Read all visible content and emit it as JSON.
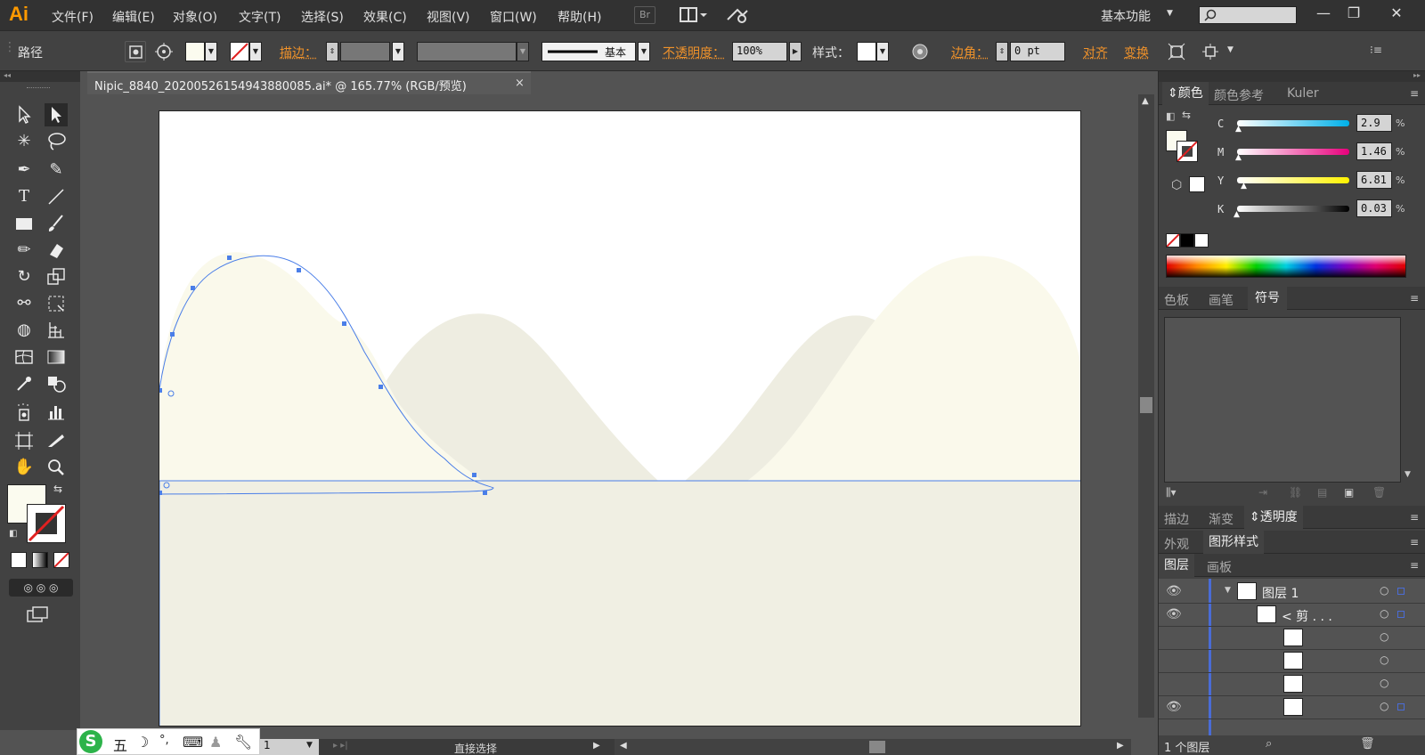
{
  "app": {
    "logo": "Ai"
  },
  "menu": [
    "文件(F)",
    "编辑(E)",
    "对象(O)",
    "文字(T)",
    "选择(S)",
    "效果(C)",
    "视图(V)",
    "窗口(W)",
    "帮助(H)"
  ],
  "menubar_icons": {
    "bridge": "Br"
  },
  "workspace": "基本功能",
  "controlbar": {
    "object_type": "路径",
    "stroke_label": "描边：",
    "brush_label": "基本",
    "opacity_label": "不透明度：",
    "opacity_value": "100%",
    "style_label": "样式：",
    "corner_label": "边角：",
    "corner_value": "0 pt",
    "align_label": "对齐",
    "transform_label": "变换"
  },
  "document": {
    "tab_title": "Nipic_8840_20200526154943880085.ai* @ 165.77% (RGB/预览)",
    "zoom": "1",
    "status": "直接选择"
  },
  "color_panel": {
    "tabs": [
      "颜色",
      "颜色参考",
      "Kuler"
    ],
    "channels": [
      {
        "label": "C",
        "value": "2.9"
      },
      {
        "label": "M",
        "value": "1.46"
      },
      {
        "label": "Y",
        "value": "6.81"
      },
      {
        "label": "K",
        "value": "0.03"
      }
    ],
    "percent": "%",
    "fill_color": "#fbfbef"
  },
  "swatch_panel": {
    "tabs": [
      "色板",
      "画笔",
      "符号"
    ]
  },
  "stroke_panel": {
    "tabs": [
      "描边",
      "渐变",
      "透明度"
    ]
  },
  "appearance_panel": {
    "tabs": [
      "外观",
      "图形样式"
    ]
  },
  "layers_panel": {
    "tabs": [
      "图层",
      "画板"
    ],
    "rows": [
      "图层 1",
      "< 剪 . . ."
    ],
    "footer": "1 个图层"
  },
  "ime": {
    "mode": "五"
  },
  "colors": {
    "accent": "#ff9a00",
    "mountain_light": "#faf9eb",
    "mountain_dark": "#eeede1",
    "ground": "#f0efe3",
    "selection": "#4a7ee8"
  }
}
